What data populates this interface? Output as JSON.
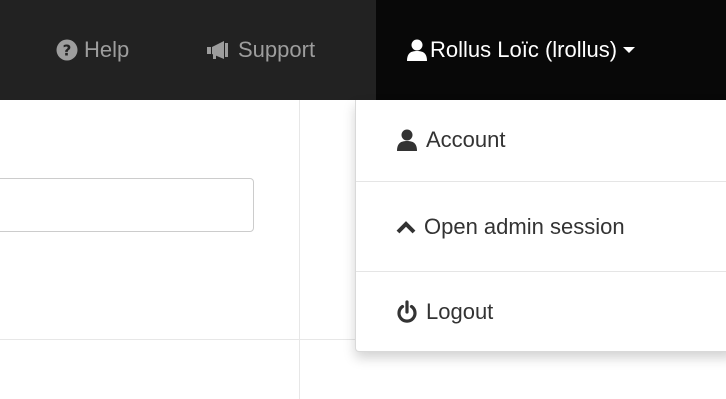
{
  "navbar": {
    "help_label": "Help",
    "support_label": "Support",
    "user_label": "Rollus Loïc (lrollus)",
    "colors": {
      "background": "#222222",
      "active_background": "#080808",
      "link": "#9d9d9d",
      "active_link": "#ffffff"
    }
  },
  "dropdown": {
    "items": [
      {
        "label": "Account",
        "icon": "user-icon"
      },
      {
        "label": "Open admin session",
        "icon": "chevron-up-icon"
      },
      {
        "label": "Logout",
        "icon": "power-icon"
      }
    ]
  },
  "search": {
    "value": "",
    "placeholder": ""
  }
}
